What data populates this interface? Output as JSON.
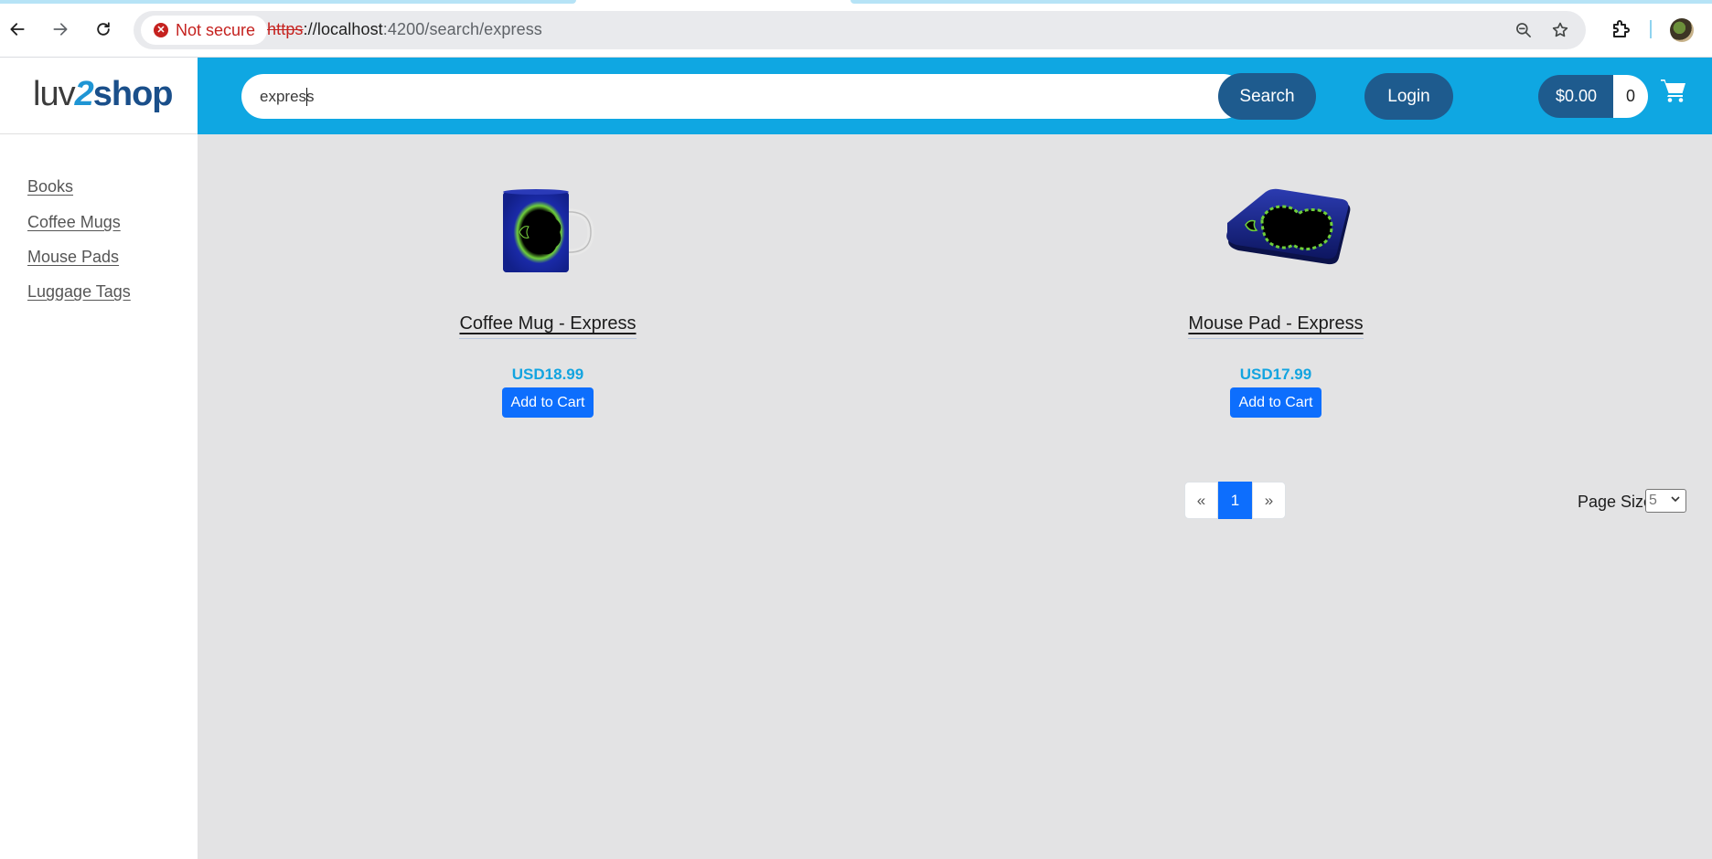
{
  "browser": {
    "security_label": "Not secure",
    "url_scheme": "https",
    "url_separator": "://",
    "url_host": "localhost",
    "url_path": ":4200/search/express"
  },
  "header": {
    "logo_part1": "luv",
    "logo_part2": "2",
    "logo_part3": "shop",
    "search_value": "express",
    "search_button": "Search",
    "login_button": "Login",
    "cart_total": "$0.00",
    "cart_count": "0"
  },
  "sidebar": {
    "items": [
      {
        "label": "Books"
      },
      {
        "label": "Coffee Mugs"
      },
      {
        "label": "Mouse Pads"
      },
      {
        "label": "Luggage Tags"
      }
    ]
  },
  "products": [
    {
      "name": "Coffee Mug - Express",
      "price": "USD18.99",
      "button": "Add to Cart"
    },
    {
      "name": "Mouse Pad - Express",
      "price": "USD17.99",
      "button": "Add to Cart"
    }
  ],
  "pagination": {
    "prev": "«",
    "current": "1",
    "next": "»",
    "page_size_label": "Page Size",
    "page_size_value": "5"
  },
  "colors": {
    "header_bar": "#0fa7e2",
    "header_buttons": "#1e5b8e",
    "price": "#13a4e0",
    "primary_button": "#0d6efd",
    "main_background": "#e3e3e4"
  }
}
